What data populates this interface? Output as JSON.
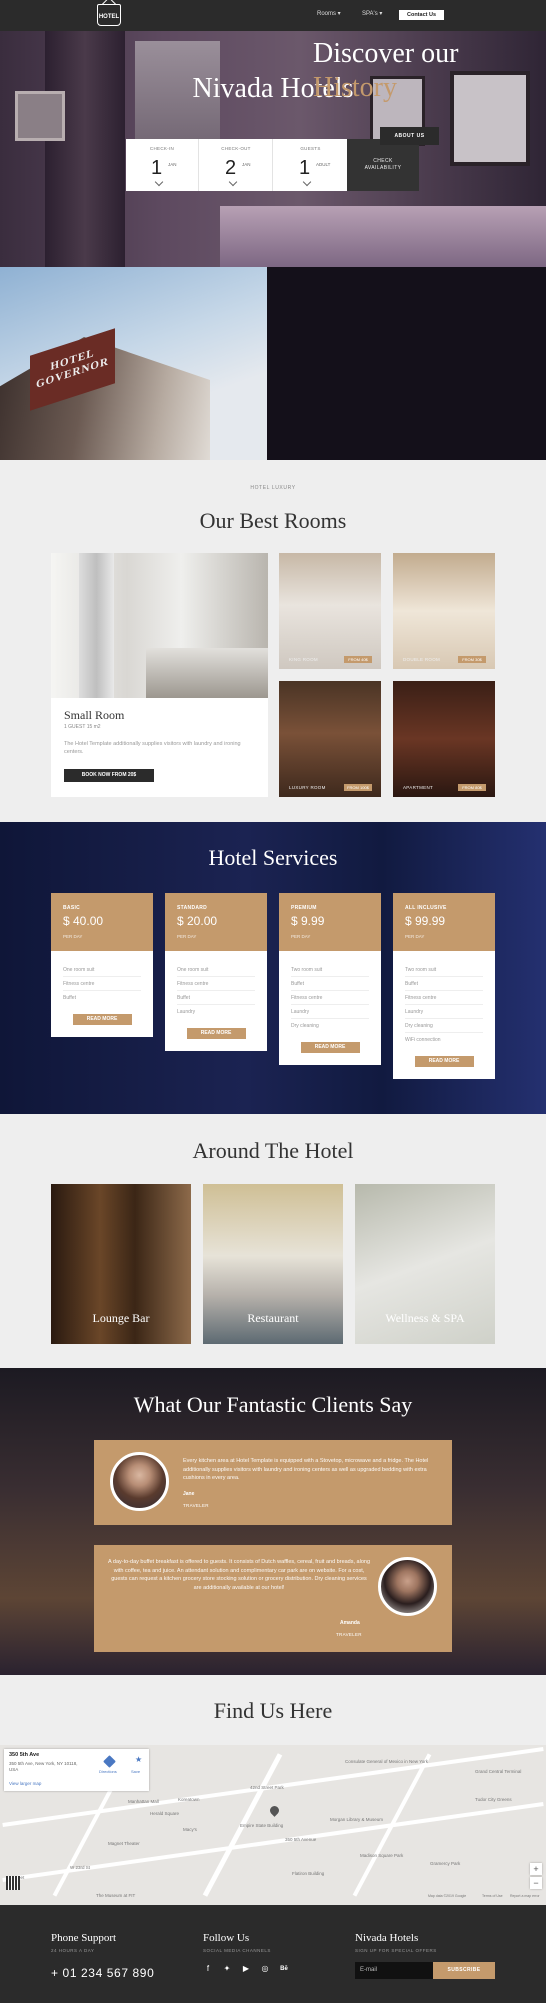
{
  "header": {
    "logo_text": "HOTEL",
    "nav": [
      {
        "label": "Rooms ▾"
      },
      {
        "label": "SPA's ▾"
      }
    ],
    "contact_button": "Contact Us"
  },
  "hero": {
    "title": "Nivada Hotels",
    "booking": [
      {
        "label": "CHECK-IN",
        "value": "1",
        "month": "JAN"
      },
      {
        "label": "CHECK-OUT",
        "value": "2",
        "month": "JAN"
      },
      {
        "label": "GUESTS",
        "value": "1",
        "month": "ADULT"
      }
    ],
    "check_button_line1": "CHECK",
    "check_button_line2": "AVAILABILITY"
  },
  "history": {
    "sign_text_1": "HOTEL",
    "sign_text_2": "GOVERNOR",
    "title_line1": "Discover our",
    "title_line2": "History",
    "button": "ABOUT US"
  },
  "rooms": {
    "kicker": "HOTEL LUXURY",
    "title": "Our Best Rooms",
    "featured": {
      "name": "Small Room",
      "meta": "1 GUEST   15 m2",
      "description": "The Hotel Template additionally supplies visitors with laundry and ironing centers.",
      "button": "BOOK NOW FROM 20$"
    },
    "tiles": [
      {
        "caption": "KING ROOM",
        "price": "FROM 40$"
      },
      {
        "caption": "DOUBLE ROOM",
        "price": "FROM 30$"
      },
      {
        "caption": "LUXURY ROOM",
        "price": "FROM 100$"
      },
      {
        "caption": "APARTMENT",
        "price": "FROM 80$"
      }
    ]
  },
  "services": {
    "title": "Hotel Services",
    "plans": [
      {
        "tier": "BASIC",
        "price": "$ 40.00",
        "per": "PER DAY",
        "features": [
          "One room suit",
          "Fitness centre",
          "Buffet"
        ],
        "button": "READ MORE"
      },
      {
        "tier": "STANDARD",
        "price": "$ 20.00",
        "per": "PER DAY",
        "features": [
          "One room suit",
          "Fitness centre",
          "Buffet",
          "Laundry"
        ],
        "button": "READ MORE"
      },
      {
        "tier": "PREMIUM",
        "price": "$ 9.99",
        "per": "PER DAY",
        "features": [
          "Two room suit",
          "Buffet",
          "Fitness centre",
          "Laundry",
          "Dry cleaning"
        ],
        "button": "READ MORE"
      },
      {
        "tier": "ALL INCLUSIVE",
        "price": "$ 99.99",
        "per": "PER DAY",
        "features": [
          "Two room suit",
          "Buffet",
          "Fitness centre",
          "Laundry",
          "Dry cleaning",
          "WiFi connection"
        ],
        "button": "READ MORE"
      }
    ]
  },
  "around": {
    "title": "Around The Hotel",
    "tiles": [
      {
        "label": "Lounge Bar"
      },
      {
        "label": "Restaurant"
      },
      {
        "label": "Wellness & SPA"
      }
    ]
  },
  "testimonials": {
    "title": "What Our Fantastic Clients Say",
    "items": [
      {
        "quote": "Every kitchen area at Hotel Template is equipped with a Stovetop, microwave and a fridge. The Hotel additionally supplies visitors with laundry and ironing centers as well as upgraded bedding with extra cushions in every area.",
        "name": "Jane",
        "role": "TRAVELER"
      },
      {
        "quote": "A day-to-day buffet breakfast is offered to guests. It consists of Dutch waffles, cereal, fruit and breads, along with coffee, tea and juice. An attendant solution and complimentary car park are on website. For a cost, guests can request a kitchen grocery store stocking solution or grocery distribution. Dry cleaning services are additionally available at our hotel!",
        "name": "Amanda",
        "role": "TRAVELER"
      }
    ]
  },
  "map_section": {
    "title": "Find Us Here",
    "card": {
      "address": "350 5th Ave",
      "address_full": "350 5th Ave, New York, NY 10118, USA",
      "directions": "Directions",
      "save": "Save",
      "large_map": "View larger map"
    },
    "labels": [
      "Manhattan Mall",
      "Herald Square",
      "Koreatown",
      "Macy's",
      "Empire State Building",
      "350 5th Avenue",
      "42nd Street Park",
      "Consulate General of Mexico in New York",
      "Grand Central Terminal",
      "Morgan Library & Museum",
      "Madison Square Park",
      "The Museum at FIT",
      "Flatiron Building",
      "Gramercy Park",
      "Tudor City Greens",
      "Magnet Theater",
      "W 23rd St",
      "23 Street",
      "Map data ©2019 Google",
      "Terms of Use",
      "Report a map error"
    ]
  },
  "footer": {
    "phone_title": "Phone Support",
    "phone_sub": "24 HOURS A DAY",
    "phone": "+ 01 234 567 890",
    "follow_title": "Follow Us",
    "follow_sub": "SOCIAL MEDIA CHANNELS",
    "social": [
      {
        "icon": "facebook-icon",
        "glyph": "f"
      },
      {
        "icon": "twitter-icon",
        "glyph": "✦"
      },
      {
        "icon": "youtube-icon",
        "glyph": "▶"
      },
      {
        "icon": "instagram-icon",
        "glyph": "◎"
      },
      {
        "icon": "behance-icon",
        "glyph": "Bē"
      }
    ],
    "brand_title": "Nivada Hotels",
    "brand_sub": "SIGN UP FOR SPECIAL OFFERS",
    "email_placeholder": "E-mail",
    "subscribe": "SUBSCRIBE"
  },
  "colors": {
    "accent": "#c49a6c",
    "dark": "#2b2b2b",
    "light_bg": "#eeeeee",
    "navy": "#1b2352"
  }
}
